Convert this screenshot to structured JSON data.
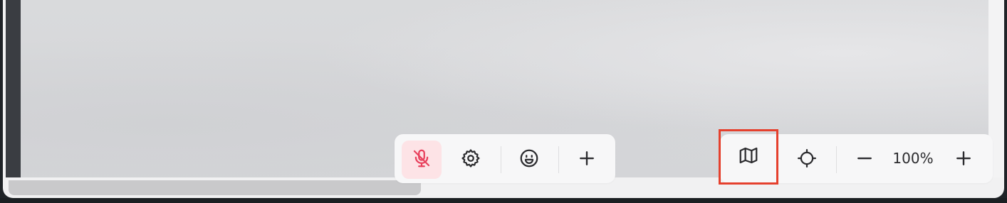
{
  "toolbar_left": {
    "mic_button": {
      "icon": "mic-off-icon",
      "active_color": "#e8405c"
    },
    "settings_button": {
      "icon": "gear-icon"
    },
    "emoji_button": {
      "icon": "smiley-icon"
    },
    "add_button": {
      "icon": "plus-icon"
    }
  },
  "toolbar_right": {
    "map_button": {
      "icon": "map-icon",
      "highlight_color": "#e5402d"
    },
    "locate_button": {
      "icon": "crosshair-icon"
    },
    "zoom_out_button": {
      "icon": "minus-icon"
    },
    "zoom_level": "100%",
    "zoom_in_button": {
      "icon": "plus-icon"
    }
  },
  "colors": {
    "canvas": "#d6d7da",
    "toolbar_bg": "#f7f7f8",
    "icon": "#2b2b2e"
  }
}
